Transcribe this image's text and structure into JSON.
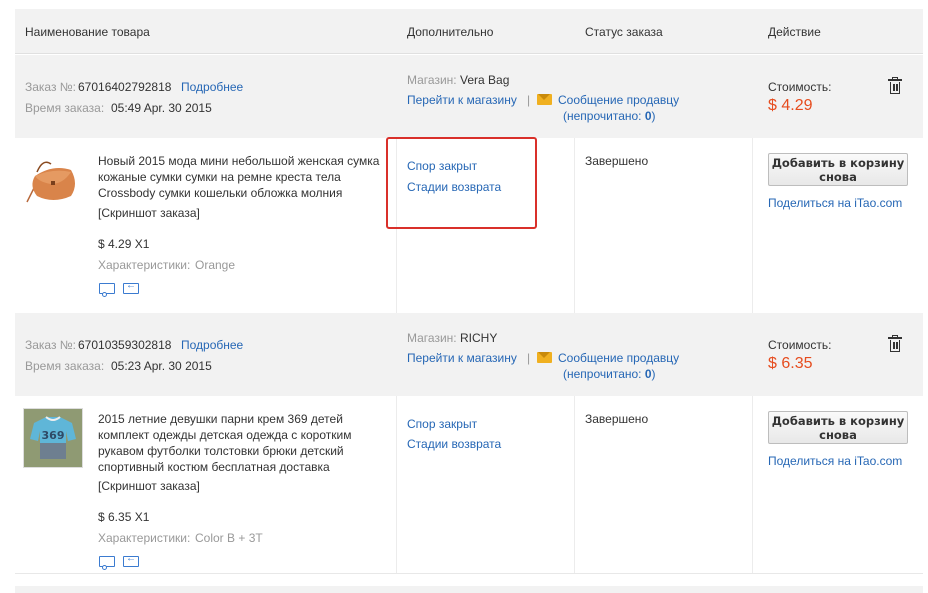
{
  "header": {
    "name": "Наименование товара",
    "extra": "Дополнительно",
    "status": "Статус заказа",
    "action": "Действие"
  },
  "labels": {
    "order_no": "Заказ №:",
    "details": "Подробнее",
    "order_time": "Время заказа:",
    "store": "Магазин:",
    "go_to_store": "Перейти к магазину",
    "message_seller": "Сообщение продавцу",
    "unread_prefix": "(непрочитано:",
    "unread_suffix": ")",
    "cost": "Стоимость:",
    "dispute_closed": "Спор закрыт",
    "return_stages": "Стадии возврата",
    "status_done": "Завершено",
    "add_to_cart_line1": "Добавить в корзину",
    "add_to_cart_line2": "снова",
    "share_on": "Поделиться на",
    "share_site": "iTao.com",
    "snapshot": "[Скриншот заказа]",
    "characteristics": "Характеристики:"
  },
  "orders": [
    {
      "number": "67016402792818",
      "time": "05:49 Apr. 30 2015",
      "store": "Vera Bag",
      "unread": "0",
      "price": "$ 4.29",
      "product_title": "Новый 2015 мода мини небольшой женская сумка кожаные сумки сумки на ремне креста тела Crossbody сумки кошельки обложка молния",
      "qty_price": "$ 4.29 X1",
      "characteristics": "Orange",
      "thumb_color": "#d9844a"
    },
    {
      "number": "67010359302818",
      "time": "05:23 Apr. 30 2015",
      "store": "RICHY",
      "unread": "0",
      "price": "$ 6.35",
      "product_title": "2015 летние девушки парни крем 369 детей комплект одежды детская одежда с коротким рукавом футболки толстовки брюки детский спортивный костюм бесплатная доставка",
      "qty_price": "$ 6.35 X1",
      "characteristics": "Color B + 3T",
      "thumb_color": "#5fb6d8"
    }
  ]
}
